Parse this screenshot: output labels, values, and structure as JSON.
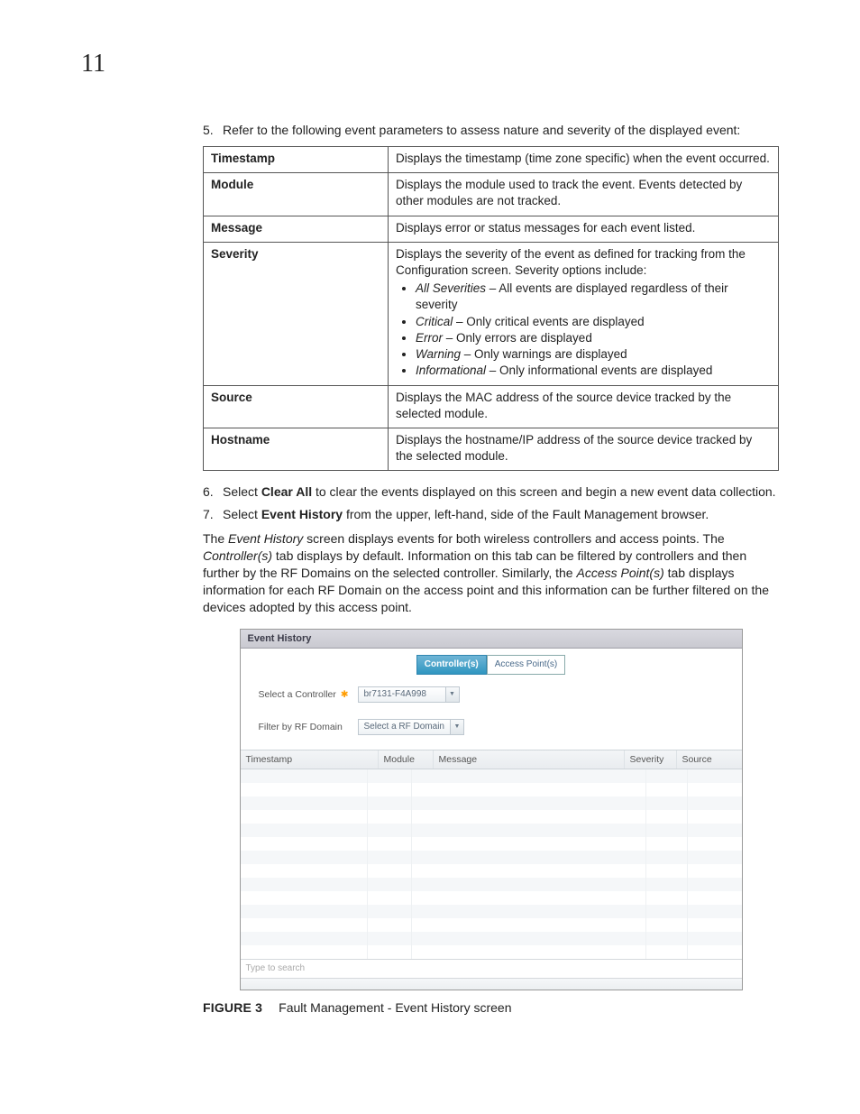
{
  "chapter_number": "11",
  "step5": {
    "num": "5.",
    "text": "Refer to the following event parameters to assess nature and severity of the displayed event:"
  },
  "table": {
    "r1": {
      "head": "Timestamp",
      "desc": "Displays the timestamp (time zone specific) when the event occurred."
    },
    "r2": {
      "head": "Module",
      "desc": "Displays the module used to track the event. Events detected by other modules are not tracked."
    },
    "r3": {
      "head": "Message",
      "desc": "Displays error or status messages for each event listed."
    },
    "r4": {
      "head": "Severity",
      "intro": "Displays the severity of the event as defined for tracking from the Configuration screen. Severity options include:",
      "items": {
        "allsev_i": "All Severities",
        "allsev_t": " – All events are displayed regardless of their severity",
        "crit_i": "Critical",
        "crit_t": " – Only critical events are displayed",
        "err_i": "Error",
        "err_t": " – Only errors are displayed",
        "warn_i": "Warning",
        "warn_t": " – Only warnings are displayed",
        "info_i": "Informational",
        "info_t": " – Only informational events are displayed"
      }
    },
    "r5": {
      "head": "Source",
      "desc": "Displays the MAC address of the source device tracked by the selected module."
    },
    "r6": {
      "head": "Hostname",
      "desc": "Displays the hostname/IP address of the source device tracked by the selected module."
    }
  },
  "step6": {
    "num": "6.",
    "pre": "Select ",
    "bold": "Clear All",
    "post": " to clear the events displayed on this screen and begin a new event data collection."
  },
  "step7": {
    "num": "7.",
    "pre": "Select ",
    "bold": "Event History",
    "post": " from the upper, left-hand, side of the Fault Management browser."
  },
  "para": {
    "p1a": "The ",
    "p1b_i": "Event History",
    "p1c": " screen displays events for both wireless controllers and access points. The ",
    "p1d_i": "Controller(s)",
    "p1e": " tab displays by default. Information on this tab can be filtered by controllers and then further by the RF Domains on the selected controller. Similarly, the ",
    "p1f_i": "Access Point(s)",
    "p1g": " tab displays information for each RF Domain on the access point and this information can be further filtered on the devices adopted by this access point."
  },
  "app": {
    "title": "Event History",
    "tabs": {
      "controllers": "Controller(s)",
      "aps": "Access Point(s)"
    },
    "filters": {
      "select_controller_label": "Select a Controller",
      "required_mark": "✱",
      "controller_value": "br7131-F4A998",
      "rfdomain_label": "Filter by RF Domain",
      "rfdomain_value": "Select a RF Domain"
    },
    "grid_headers": {
      "timestamp": "Timestamp",
      "module": "Module",
      "message": "Message",
      "severity": "Severity",
      "source": "Source"
    },
    "search_placeholder": "Type to search"
  },
  "figure": {
    "label": "FIGURE 3",
    "caption": "Fault Management - Event History screen"
  }
}
